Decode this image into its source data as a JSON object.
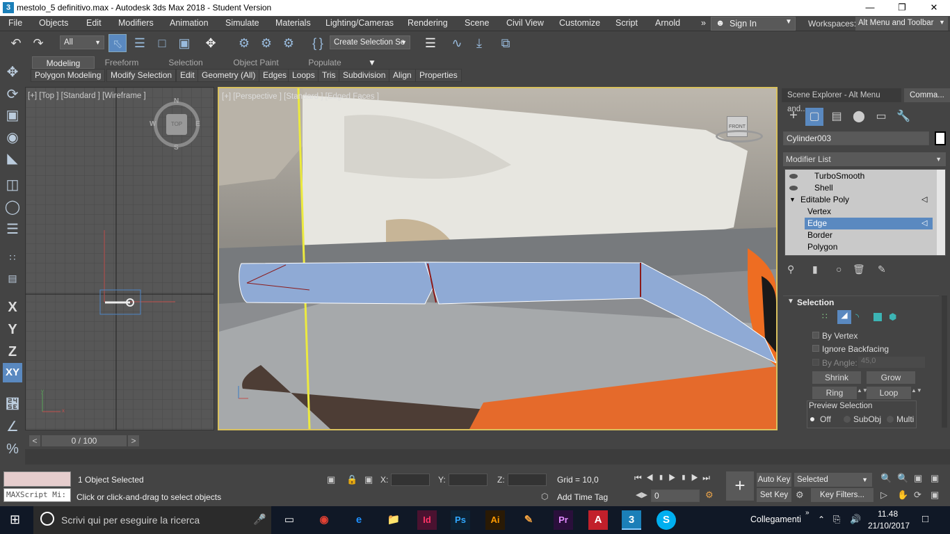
{
  "titlebar": {
    "title": "mestolo_5 definitivo.max - Autodesk 3ds Max 2018 - Student Version",
    "app_icon": "3",
    "minimize": "—",
    "maximize": "❐",
    "close": "✕"
  },
  "menu": [
    "File",
    "Objects",
    "Edit",
    "Modifiers",
    "Animation",
    "Simulate",
    "Materials",
    "Lighting/Cameras",
    "Rendering",
    "Scene",
    "Civil View",
    "Customize",
    "Script",
    "Arnold"
  ],
  "menu_more": "»",
  "signin": {
    "label": "Sign In"
  },
  "workspaces": {
    "label": "Workspaces:",
    "value": "Alt Menu and Toolbar"
  },
  "toolbar": {
    "filter_value": "All",
    "selection_set": "Create Selection Se"
  },
  "ribbon": {
    "tabs": [
      "Modeling",
      "Freeform",
      "Selection",
      "Object Paint",
      "Populate"
    ],
    "buttons": [
      "Polygon Modeling",
      "Modify Selection",
      "Edit",
      "Geometry (All)",
      "Edges",
      "Loops",
      "Tris",
      "Subdivision",
      "Align",
      "Properties"
    ]
  },
  "viewport_top": {
    "label": "[+] [Top ] [Standard ] [Wireframe ]",
    "compass": {
      "n": "N",
      "s": "S",
      "e": "E",
      "w": "W",
      "center": "TOP"
    },
    "axis_y": "y",
    "axis_x": "x"
  },
  "viewport_persp": {
    "label": "[+] [Perspective ] [Standard ] [Edged Faces ]",
    "viewcube": "FRONT"
  },
  "command_panel": {
    "scene_explorer_tab": "Scene Explorer - Alt Menu and...",
    "command_tab": "Comma...",
    "object_name": "Cylinder003",
    "modifier_list": "Modifier List",
    "stack": [
      {
        "label": "TurboSmooth",
        "level": 0,
        "selected": false
      },
      {
        "label": "Shell",
        "level": 0,
        "selected": false
      },
      {
        "label": "Editable Poly",
        "level": 0,
        "selected": false
      },
      {
        "label": "Vertex",
        "level": 1,
        "selected": false
      },
      {
        "label": "Edge",
        "level": 1,
        "selected": true
      },
      {
        "label": "Border",
        "level": 1,
        "selected": false
      },
      {
        "label": "Polygon",
        "level": 1,
        "selected": false
      }
    ],
    "selection": {
      "title": "Selection",
      "by_vertex": "By Vertex",
      "ignore_backfacing": "Ignore Backfacing",
      "by_angle": "By Angle:",
      "angle_value": "45,0",
      "shrink": "Shrink",
      "grow": "Grow",
      "ring": "Ring",
      "loop": "Loop",
      "preview_title": "Preview Selection",
      "preview_options": [
        "Off",
        "SubObj",
        "Multi"
      ],
      "preview_selected": "Off"
    }
  },
  "timeline": {
    "frame": "0 / 100",
    "prev": "<",
    "next": ">"
  },
  "status": {
    "maxscript": "MAXScript Mi:",
    "selected_count": "1 Object Selected",
    "prompt": "Click or click-and-drag to select objects",
    "x_label": "X:",
    "y_label": "Y:",
    "z_label": "Z:",
    "grid": "Grid = 10,0",
    "add_time_tag": "Add Time Tag",
    "auto_key": "Auto Key",
    "set_key": "Set Key",
    "key_filter_value": "Selected",
    "key_filters": "Key Filters...",
    "frame_value": "0"
  },
  "taskbar": {
    "search_placeholder": "Scrivi qui per eseguire la ricerca",
    "network_label": "Collegamenti",
    "time": "11.48",
    "date": "21/10/2017"
  }
}
